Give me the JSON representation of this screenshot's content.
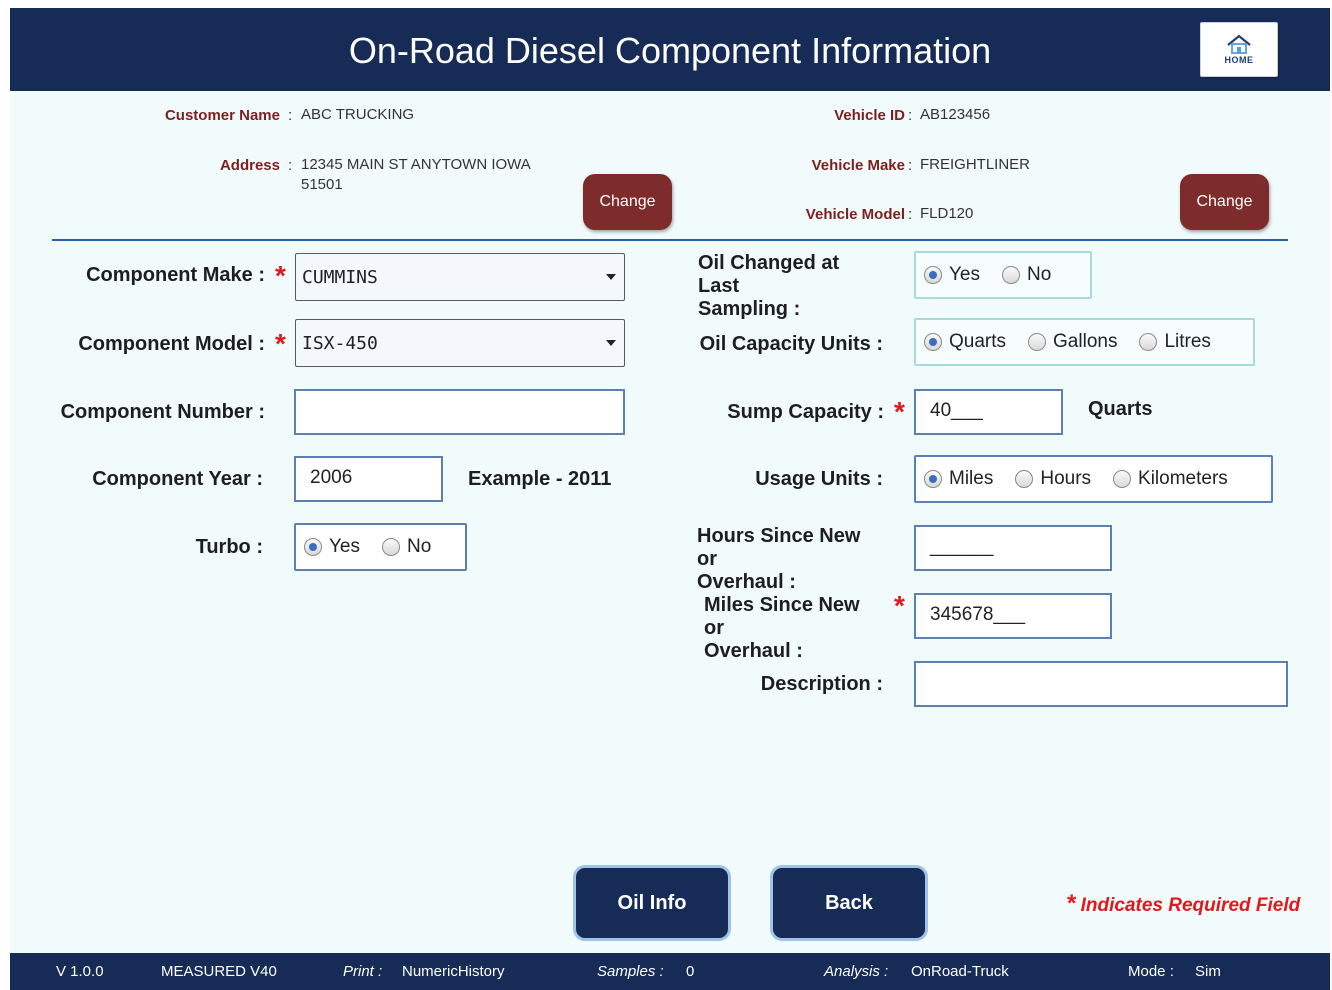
{
  "header": {
    "title": "On-Road Diesel Component Information",
    "home_label": "HOME"
  },
  "customer": {
    "name_label": "Customer Name",
    "name": "ABC TRUCKING",
    "address_label": "Address",
    "address_line1": "12345 MAIN ST ANYTOWN IOWA",
    "address_line2": "51501",
    "change_label": "Change"
  },
  "vehicle": {
    "id_label": "Vehicle ID",
    "id": "AB123456",
    "make_label": "Vehicle Make",
    "make": "FREIGHTLINER",
    "model_label": "Vehicle Model",
    "model": "FLD120",
    "change_label": "Change"
  },
  "separator": ":",
  "left_form": {
    "component_make": {
      "label": "Component Make :",
      "value": "CUMMINS"
    },
    "component_model": {
      "label": "Component Model :",
      "value": "ISX-450"
    },
    "component_number": {
      "label": "Component Number :",
      "value": ""
    },
    "component_year": {
      "label": "Component Year :",
      "value": "2006",
      "example": "Example - 2011"
    },
    "turbo": {
      "label": "Turbo :",
      "options": [
        "Yes",
        "No"
      ],
      "selected": "Yes"
    }
  },
  "right_form": {
    "oil_changed": {
      "label_line1": "Oil Changed at Last",
      "label_line2": "Sampling :",
      "options": [
        "Yes",
        "No"
      ],
      "selected": "Yes"
    },
    "oil_capacity_units": {
      "label": "Oil Capacity Units :",
      "options": [
        "Quarts",
        "Gallons",
        "Litres"
      ],
      "selected": "Quarts"
    },
    "sump_capacity": {
      "label": "Sump Capacity :",
      "value": "40___",
      "unit": "Quarts"
    },
    "usage_units": {
      "label": "Usage Units :",
      "options": [
        "Miles",
        "Hours",
        "Kilometers"
      ],
      "selected": "Miles"
    },
    "hours_since_new": {
      "label_line1": "Hours Since New or",
      "label_line2": "Overhaul :",
      "value": "______"
    },
    "miles_since_new": {
      "label_line1": "Miles Since New or",
      "label_line2": "Overhaul :",
      "value": "345678___"
    },
    "description": {
      "label": "Description :",
      "value": ""
    }
  },
  "actions": {
    "oil_info": "Oil Info",
    "back": "Back"
  },
  "required_mark": "*",
  "required_note": "Indicates Required Field",
  "status_bar": {
    "version": "V 1.0.0",
    "measured": "MEASURED V40",
    "print_label": "Print :",
    "print_value": "NumericHistory",
    "samples_label": "Samples :",
    "samples_value": "0",
    "analysis_label": "Analysis :",
    "analysis_value": "OnRoad-Truck",
    "mode_label": "Mode :",
    "mode_value": "Sim"
  },
  "colors": {
    "navy": "#162c57",
    "maroon": "#7e2b2b",
    "required_red": "#e0191d",
    "background": "#f1fbfc"
  }
}
